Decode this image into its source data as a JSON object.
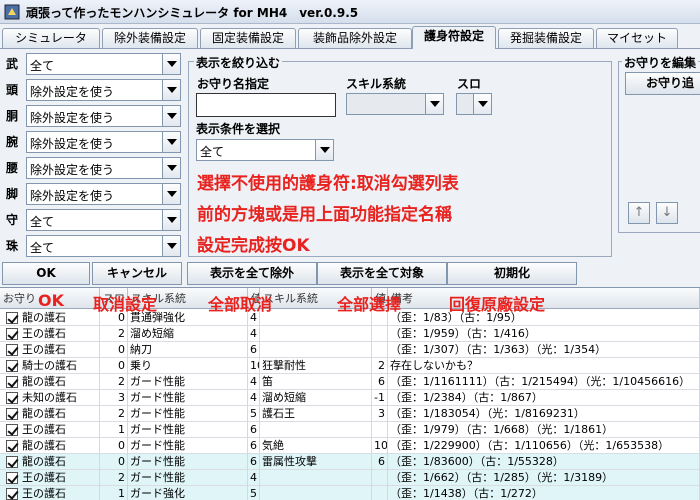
{
  "window": {
    "title": "頑張って作ったモンハンシミュレータ for MH4　ver.0.9.5"
  },
  "tabs": [
    {
      "label": "シミュレータ"
    },
    {
      "label": "除外装備設定"
    },
    {
      "label": "固定装備設定"
    },
    {
      "label": "装飾品除外設定"
    },
    {
      "label": "護身符設定"
    },
    {
      "label": "発掘装備設定"
    },
    {
      "label": "マイセット"
    }
  ],
  "slots": [
    {
      "label": "武",
      "value": "全て"
    },
    {
      "label": "頭",
      "value": "除外設定を使う"
    },
    {
      "label": "胴",
      "value": "除外設定を使う"
    },
    {
      "label": "腕",
      "value": "除外設定を使う"
    },
    {
      "label": "腰",
      "value": "除外設定を使う"
    },
    {
      "label": "脚",
      "value": "除外設定を使う"
    },
    {
      "label": "守",
      "value": "全て"
    },
    {
      "label": "珠",
      "value": "全て"
    }
  ],
  "filter": {
    "title": "表示を絞り込む",
    "name_label": "お守り名指定",
    "name_value": "",
    "skill_label": "スキル系統",
    "slot_label": "スロ",
    "cond_label": "表示条件を選択",
    "cond_value": "全て"
  },
  "edit_panel": {
    "title": "お守りを編集",
    "button": "お守り追"
  },
  "buttons": {
    "ok": "OK",
    "cancel": "キャンセル",
    "exclude_all": "表示を全て除外",
    "include_all": "表示を全て対象",
    "reset": "初期化",
    "up": "↑",
    "down": "↓"
  },
  "annotations": {
    "line1": "選擇不使用的護身符:取消勾選列表",
    "line2": "前的方塊或是用上面功能指定名稱",
    "line3": "設定完成按OK",
    "ok_note": "OK",
    "cancel_note": "取消設定",
    "exclude_note": "全部取消",
    "include_note": "全部選擇",
    "reset_note": "回復原廠設定"
  },
  "table": {
    "headers": [
      "お守り",
      "スロ",
      "スキル系統",
      "値",
      "スキル系統",
      "値",
      "備考"
    ],
    "rows": [
      {
        "name": "龍の護石",
        "slot": "0",
        "skill1": "貫通弾強化",
        "val1": "4",
        "skill2": "",
        "val2": "",
        "note": "（歪：1/83）（古：1/95）"
      },
      {
        "name": "王の護石",
        "slot": "2",
        "skill1": "溜め短縮",
        "val1": "4",
        "skill2": "",
        "val2": "",
        "note": "（歪：1/959）（古：1/416）"
      },
      {
        "name": "王の護石",
        "slot": "0",
        "skill1": "納刀",
        "val1": "6",
        "skill2": "",
        "val2": "",
        "note": "（歪：1/307）（古：1/363）（光：1/354）"
      },
      {
        "name": "騎士の護石",
        "slot": "0",
        "skill1": "乗り",
        "val1": "10",
        "skill2": "狂撃耐性",
        "val2": "2",
        "note": "存在しないかも？"
      },
      {
        "name": "龍の護石",
        "slot": "2",
        "skill1": "ガード性能",
        "val1": "4",
        "skill2": "笛",
        "val2": "6",
        "note": "（歪：1/1161111）（古：1/215494）（光：1/10456616）"
      },
      {
        "name": "未知の護石",
        "slot": "3",
        "skill1": "ガード性能",
        "val1": "4",
        "skill2": "溜め短縮",
        "val2": "-1",
        "note": "（歪：1/2384）（古：1/867）"
      },
      {
        "name": "龍の護石",
        "slot": "2",
        "skill1": "ガード性能",
        "val1": "5",
        "skill2": "護石王",
        "val2": "3",
        "note": "（歪：1/183054）（光：1/8169231）"
      },
      {
        "name": "王の護石",
        "slot": "1",
        "skill1": "ガード性能",
        "val1": "6",
        "skill2": "",
        "val2": "",
        "note": "（歪：1/979）（古：1/668）（光：1/1861）"
      },
      {
        "name": "龍の護石",
        "slot": "0",
        "skill1": "ガード性能",
        "val1": "6",
        "skill2": "気絶",
        "val2": "10",
        "note": "（歪：1/229900）（古：1/110656）（光：1/653538）"
      },
      {
        "name": "龍の護石",
        "slot": "0",
        "skill1": "ガード性能",
        "val1": "6",
        "skill2": "雷属性攻撃",
        "val2": "6",
        "note": "（歪：1/83600）（古：1/55328）"
      },
      {
        "name": "王の護石",
        "slot": "2",
        "skill1": "ガード性能",
        "val1": "4",
        "skill2": "",
        "val2": "",
        "note": "（歪：1/662）（古：1/285）（光：1/3189）"
      },
      {
        "name": "王の護石",
        "slot": "1",
        "skill1": "ガード強化",
        "val1": "5",
        "skill2": "",
        "val2": "",
        "note": "（歪：1/1438）（古：1/272）"
      }
    ]
  }
}
